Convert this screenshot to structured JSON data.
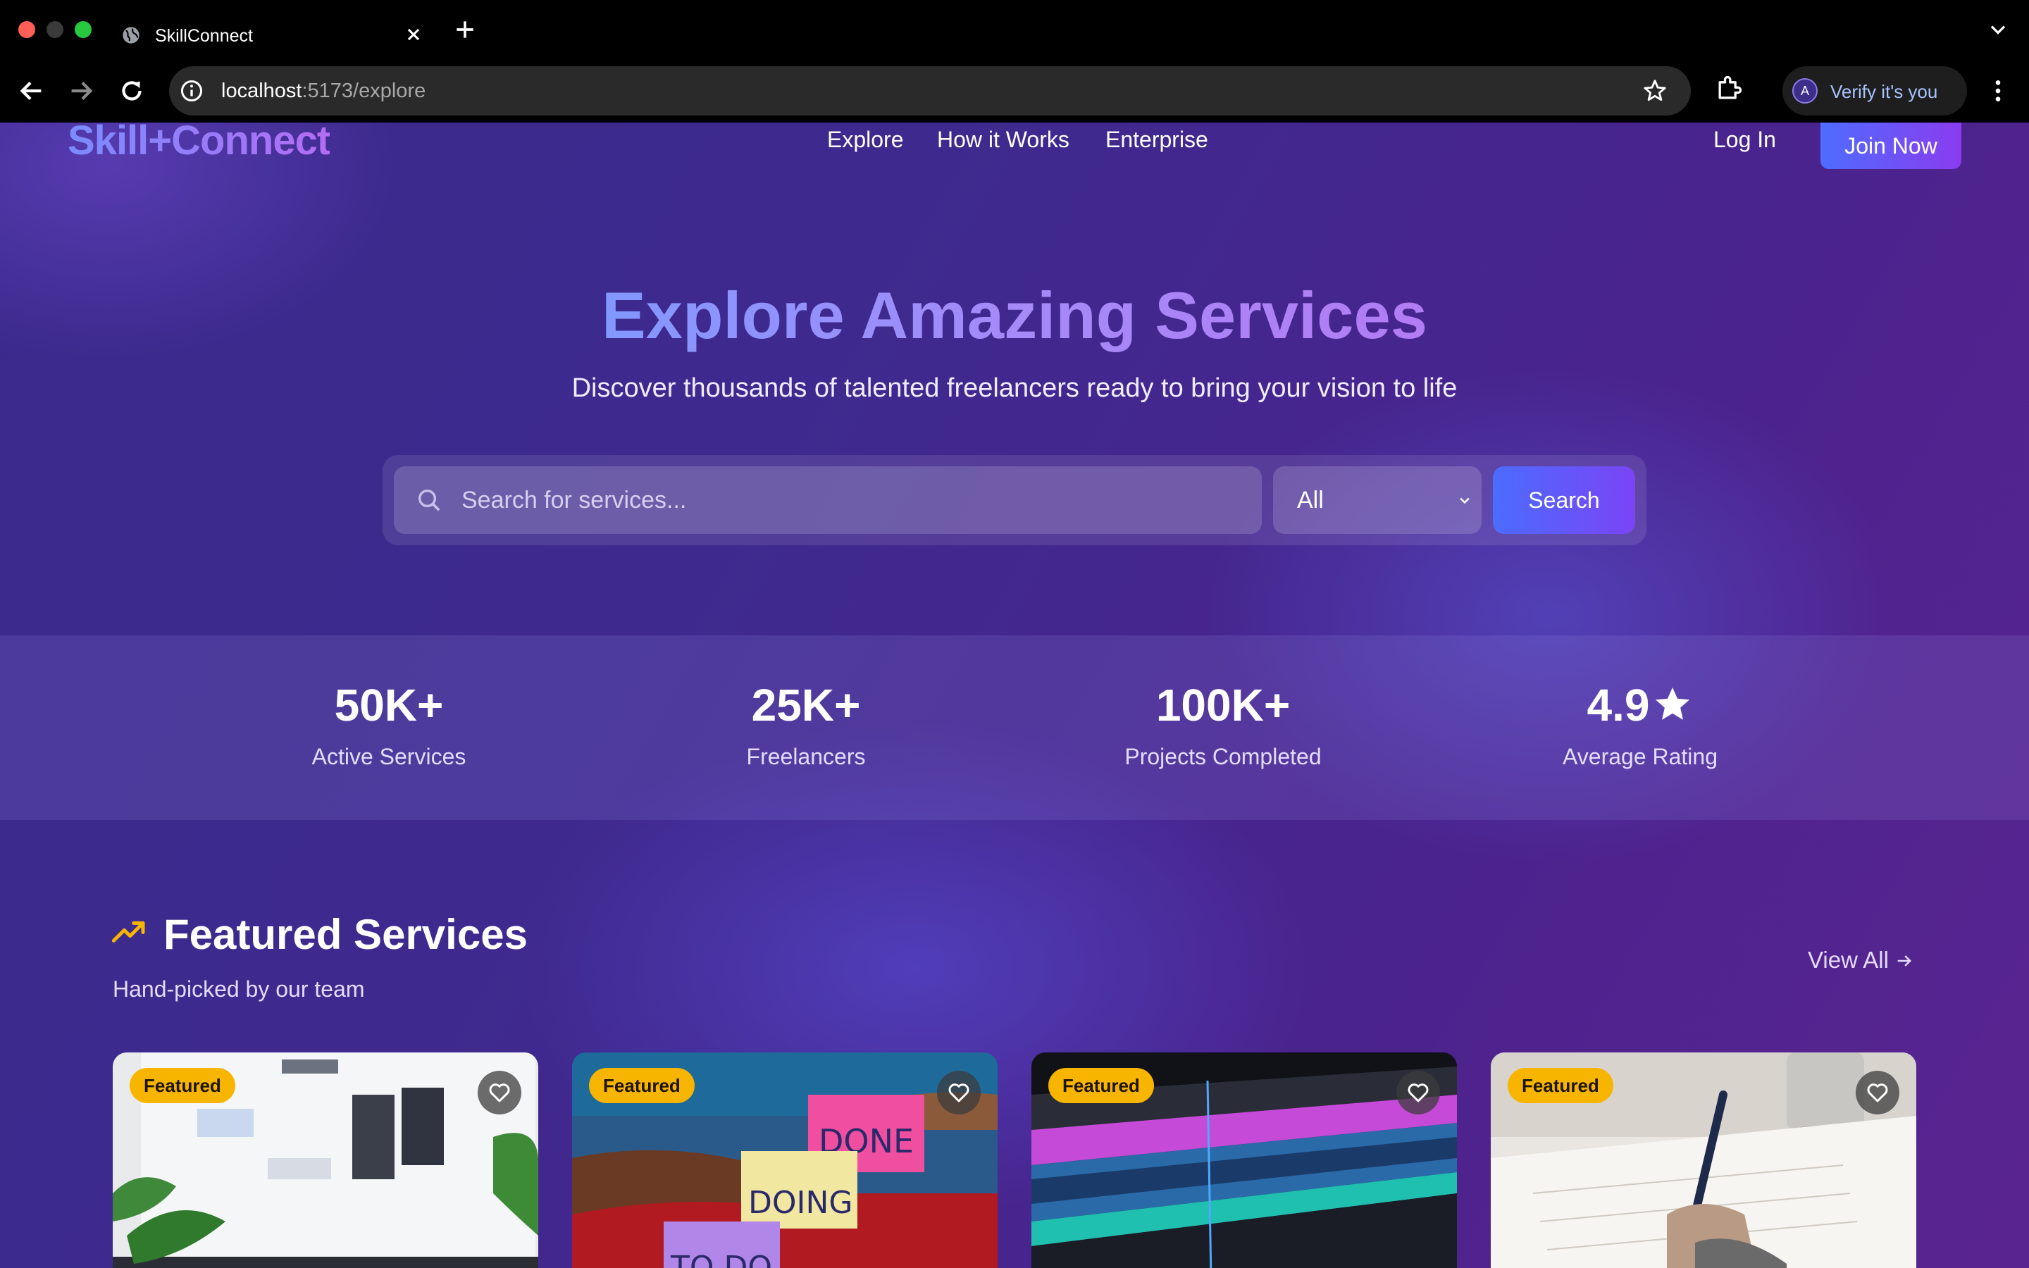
{
  "browser": {
    "tab_title": "SkillConnect",
    "url_host": "localhost",
    "url_path": ":5173/explore",
    "verify_label": "Verify it's you",
    "avatar_letter": "A"
  },
  "nav": {
    "brand": "Skill+Connect",
    "links": [
      "Explore",
      "How it Works",
      "Enterprise"
    ],
    "login": "Log In",
    "join": "Join Now"
  },
  "hero": {
    "title": "Explore Amazing Services",
    "subtitle": "Discover thousands of talented freelancers ready to bring your vision to life",
    "search_placeholder": "Search for services...",
    "category_value": "All",
    "search_button": "Search"
  },
  "stats": [
    {
      "value": "50K+",
      "label": "Active Services"
    },
    {
      "value": "25K+",
      "label": "Freelancers"
    },
    {
      "value": "100K+",
      "label": "Projects Completed"
    },
    {
      "value": "4.9",
      "label": "Average Rating"
    }
  ],
  "featured": {
    "title": "Featured Services",
    "subtitle": "Hand-picked by our team",
    "view_all": "View All",
    "badge": "Featured",
    "cards": [
      {
        "image": "ui-design-laptop"
      },
      {
        "image": "kanban-sticky-notes",
        "note_done": "DONE",
        "note_doing": "DOING",
        "note_todo": "TO DO"
      },
      {
        "image": "video-editing-timeline"
      },
      {
        "image": "writing-notebook"
      }
    ]
  },
  "colors": {
    "accent": "#5b6cff",
    "badge": "#f7b500",
    "trend_icon": "#f7b500"
  }
}
